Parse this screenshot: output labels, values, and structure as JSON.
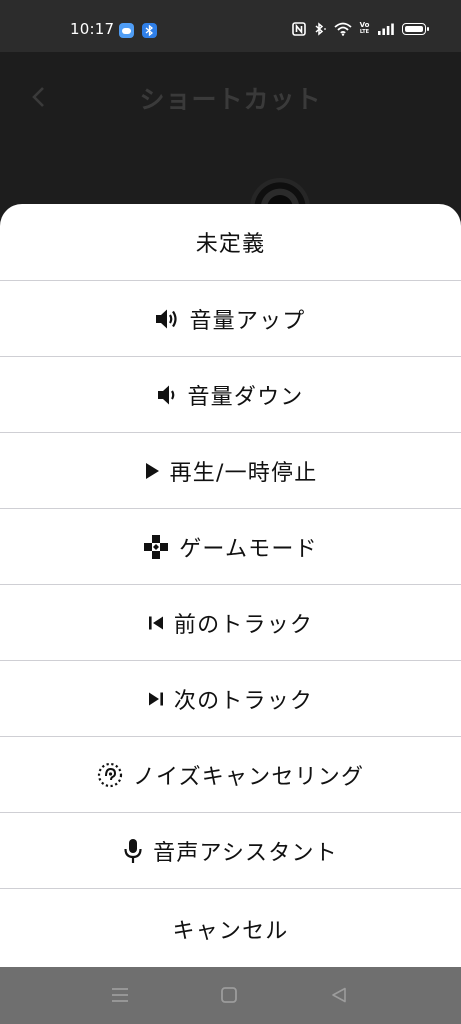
{
  "status_bar": {
    "time": "10:17",
    "badges": [
      "weather-app-icon",
      "bluetooth-app-icon"
    ],
    "indicators": [
      "nfc-icon",
      "bluetooth-icon",
      "wifi-icon",
      "volte-icon",
      "signal-icon",
      "battery-icon"
    ],
    "volte_label_top": "Vo",
    "volte_label_bottom": "LTE"
  },
  "background_page": {
    "title": "ショートカット",
    "back_icon": "chevron-left-icon"
  },
  "sheet": {
    "options": [
      {
        "id": "undefined",
        "label": "未定義",
        "icon": null
      },
      {
        "id": "volume-up",
        "label": "音量アップ",
        "icon": "volume-up-icon"
      },
      {
        "id": "volume-down",
        "label": "音量ダウン",
        "icon": "volume-down-icon"
      },
      {
        "id": "play-pause",
        "label": "再生/一時停止",
        "icon": "play-icon"
      },
      {
        "id": "game-mode",
        "label": "ゲームモード",
        "icon": "gamepad-icon"
      },
      {
        "id": "previous-track",
        "label": "前のトラック",
        "icon": "previous-track-icon"
      },
      {
        "id": "next-track",
        "label": "次のトラック",
        "icon": "next-track-icon"
      },
      {
        "id": "noise-cancelling",
        "label": "ノイズキャンセリング",
        "icon": "noise-cancelling-icon"
      },
      {
        "id": "voice-assistant",
        "label": "音声アシスタント",
        "icon": "microphone-icon"
      }
    ],
    "cancel_label": "キャンセル"
  },
  "nav_bar": {
    "buttons": [
      "menu-icon",
      "home-icon",
      "back-icon"
    ]
  },
  "colors": {
    "sheet_background": "#ffffff",
    "divider": "#cfcfd4",
    "text": "#111111",
    "nav_bar": "#6f6f6f",
    "status_bar": "#2c2c2c"
  }
}
